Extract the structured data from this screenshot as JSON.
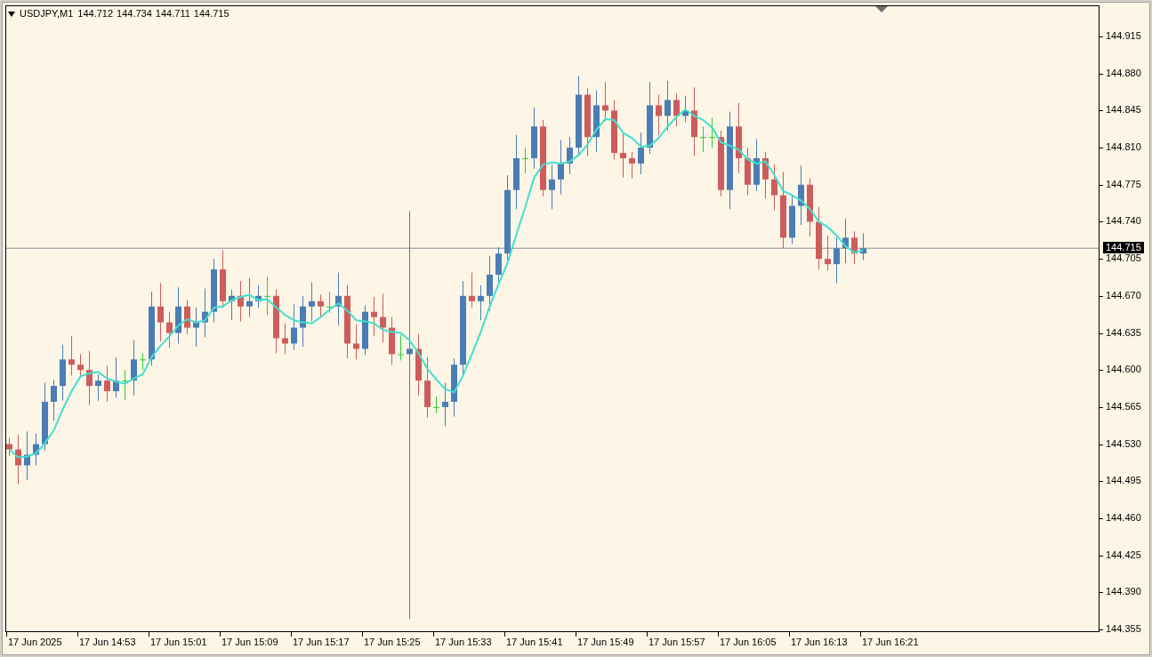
{
  "header": {
    "symbol": "USDJPY,M1",
    "quotes": [
      "144.712",
      "144.734",
      "144.711",
      "144.715"
    ]
  },
  "price_axis": {
    "labels": [
      "144.915",
      "144.880",
      "144.845",
      "144.810",
      "144.775",
      "144.740",
      "144.705",
      "144.670",
      "144.635",
      "144.600",
      "144.565",
      "144.530",
      "144.495",
      "144.460",
      "144.425",
      "144.390",
      "144.355"
    ],
    "current_price": "144.715"
  },
  "time_axis": {
    "labels": [
      "17 Jun 2025",
      "17 Jun 14:53",
      "17 Jun 15:01",
      "17 Jun 15:09",
      "17 Jun 15:17",
      "17 Jun 15:25",
      "17 Jun 15:33",
      "17 Jun 15:41",
      "17 Jun 15:49",
      "17 Jun 15:57",
      "17 Jun 16:05",
      "17 Jun 16:13",
      "17 Jun 16:21"
    ]
  }
}
